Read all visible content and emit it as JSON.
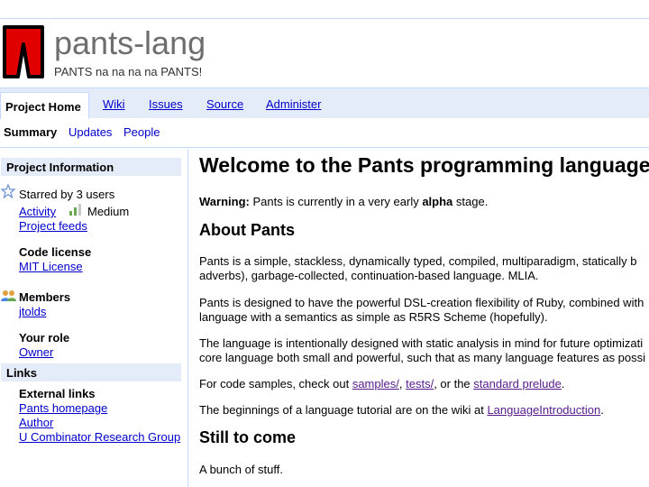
{
  "header": {
    "project_name": "pants-lang",
    "tagline": "PANTS na na na na PANTS!",
    "logo_icon": "pants-logo-icon"
  },
  "tabs": {
    "project_home": "Project Home",
    "wiki": "Wiki",
    "issues": "Issues",
    "source": "Source",
    "administer": "Administer"
  },
  "subtabs": {
    "summary": "Summary",
    "updates": "Updates",
    "people": "People"
  },
  "sidebar": {
    "project_info_heading": "Project Information",
    "starred": "Starred by 3 users",
    "activity_link": "Activity",
    "activity_level": "Medium",
    "project_feeds": "Project feeds",
    "code_license_label": "Code license",
    "license_link": "MIT License",
    "members_label": "Members",
    "member_link": "jtolds",
    "your_role_label": "Your role",
    "role_link": "Owner",
    "links_heading": "Links",
    "external_links_label": "External links",
    "external_links": [
      "Pants homepage",
      "Author",
      "U Combinator Research Group"
    ]
  },
  "main": {
    "title": "Welcome to the Pants programming language",
    "warning_label": "Warning:",
    "warning_pre": "Pants is currently in a very early",
    "warning_bold": "alpha",
    "warning_post": "stage.",
    "about_heading": "About Pants",
    "p1_line1": "Pants is a simple, stackless, dynamically typed, compiled, multiparadigm, statically b",
    "p1_line2": "adverbs), garbage-collected, continuation-based language. MLIA.",
    "p2_line1": "Pants is designed to have the powerful DSL-creation flexibility of Ruby, combined with",
    "p2_line2": "language with a semantics as simple as R5RS Scheme (hopefully).",
    "p3_line1": "The language is intentionally designed with static analysis in mind for future optimizati",
    "p3_line2": "core language both small and powerful, such that as many language features as possi",
    "samples_pre": "For code samples, check out",
    "samples_link1": "samples/",
    "samples_sep1": ",",
    "samples_link2": "tests/",
    "samples_mid": ", or the",
    "samples_link3": "standard prelude",
    "samples_end": ".",
    "tutorial_pre": "The beginnings of a language tutorial are on the wiki at",
    "tutorial_link": "LanguageIntroduction",
    "tutorial_end": ".",
    "still_heading": "Still to come",
    "still_text": "A bunch of stuff."
  },
  "colors": {
    "tab_bg": "#e5ecf9",
    "border": "#c3d9ff",
    "link": "#0000cc",
    "visited": "#551a8b",
    "logo_red": "#e00000"
  }
}
